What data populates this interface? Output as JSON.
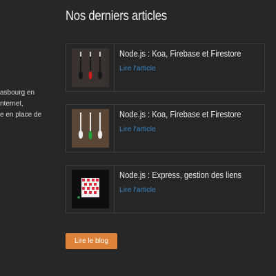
{
  "sidebar": {
    "lines": [
      "asbourg en",
      "nternet,",
      "e en place de"
    ]
  },
  "section": {
    "title": "Nos derniers articles"
  },
  "articles": [
    {
      "title": "Node.js : Koa, Firebase et Firestore gestion ...",
      "link": "Lire l'article",
      "thumb": "darts-dark-red"
    },
    {
      "title": "Node.js : Koa, Firebase et Firestore gestion ...",
      "link": "Lire l'article",
      "thumb": "darts-wood-green"
    },
    {
      "title": "Node.js : Express, gestion des liens actifs a...",
      "link": "Lire l'article",
      "thumb": "patterned-cube"
    }
  ],
  "blog_button": {
    "label": "Lire le blog"
  },
  "colors": {
    "background": "#272727",
    "accent": "#e0833a",
    "link": "#3a87c8"
  }
}
